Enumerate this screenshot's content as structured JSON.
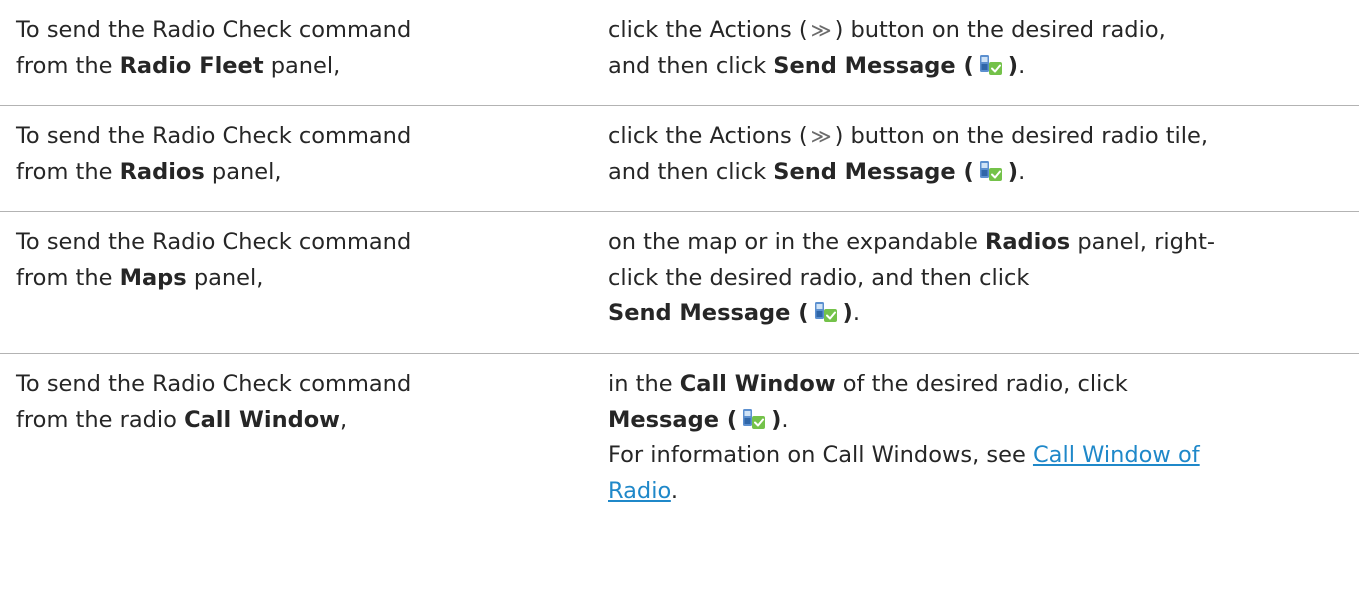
{
  "rows": [
    {
      "left_prefix": "To send the Radio Check command",
      "left_from": "from the ",
      "left_bold": "Radio Fleet",
      "left_suffix": " panel,",
      "right_line1_a": "click the Actions (",
      "right_line1_glyph": "≫",
      "right_line1_b": ") button on the desired radio,",
      "right_line2_a": "and then click ",
      "right_line2_bold": "Send Message (",
      "right_line2_bold_close": ")",
      "right_line2_end": "."
    },
    {
      "left_prefix": "To send the Radio Check command",
      "left_from": "from the ",
      "left_bold": "Radios",
      "left_suffix": " panel,",
      "right_line1_a": "click the Actions (",
      "right_line1_glyph": "≫",
      "right_line1_b": ") button on the desired radio tile,",
      "right_line2_a": "and then click ",
      "right_line2_bold": "Send Message (",
      "right_line2_bold_close": ")",
      "right_line2_end": "."
    },
    {
      "left_prefix": "To send the Radio Check command",
      "left_from": "from the ",
      "left_bold": "Maps",
      "left_suffix": " panel,",
      "right_line1_a": "on the map or in the expandable ",
      "right_line1_bold": "Radios",
      "right_line1_b": " panel, right-",
      "right_line2": "click the desired radio, and then click",
      "right_line3_bold": "Send Message (",
      "right_line3_bold_close": ")",
      "right_line3_end": "."
    },
    {
      "left_prefix": "To send the Radio Check command",
      "left_from": "from the radio ",
      "left_bold": "Call Window",
      "left_suffix": ",",
      "right_line1_a": "in the ",
      "right_line1_bold": "Call Window",
      "right_line1_b": " of the desired radio, click",
      "right_line2_bold": "Message (",
      "right_line2_bold_close": ")",
      "right_line2_end": ".",
      "right_line3": "For information on Call Windows, see ",
      "right_link_line1": "Call Window of",
      "right_link_line2": "Radio",
      "right_line4_end": "."
    }
  ],
  "icons": {
    "actions": "double-chevron-right-icon",
    "message": "send-message-icon"
  },
  "colors": {
    "text": "#262626",
    "link": "#1f88c9",
    "divider": "#b3b3b3",
    "icon_green": "#5dbb3c",
    "icon_blue": "#4a86c5"
  }
}
